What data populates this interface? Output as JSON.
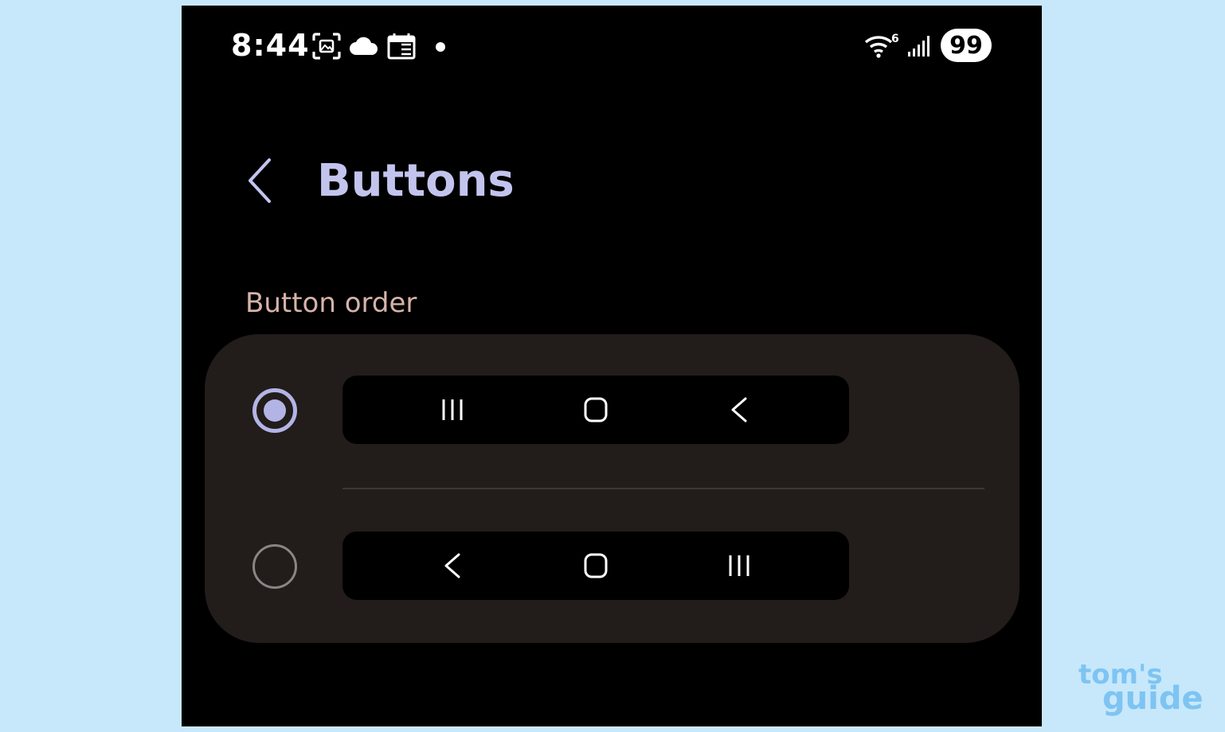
{
  "status_bar": {
    "time": "8:44",
    "left_icons": [
      "screenshot-icon",
      "cloud-icon",
      "calendar-icon",
      "notification-dot-icon"
    ],
    "right_icons": [
      "wifi6-icon",
      "signal-icon"
    ],
    "wifi_label": "6",
    "battery": "99"
  },
  "header": {
    "back_icon": "chevron-left-icon",
    "title": "Buttons"
  },
  "section": {
    "label": "Button order"
  },
  "options": [
    {
      "selected": true,
      "icons": [
        "recents-icon",
        "home-icon",
        "back-icon"
      ]
    },
    {
      "selected": false,
      "icons": [
        "back-icon",
        "home-icon",
        "recents-icon"
      ]
    }
  ],
  "watermark": {
    "line1": "tom's",
    "line2": "guide"
  },
  "colors": {
    "page_bg": "#c7e8fb",
    "screen_bg": "#000000",
    "title": "#c3c4ee",
    "section_label": "#d6b3a8",
    "card_bg": "#221c1a",
    "radio_selected": "#b3b4e6",
    "radio_unselected": "#8a8584",
    "watermark": "#7ec4f2"
  }
}
